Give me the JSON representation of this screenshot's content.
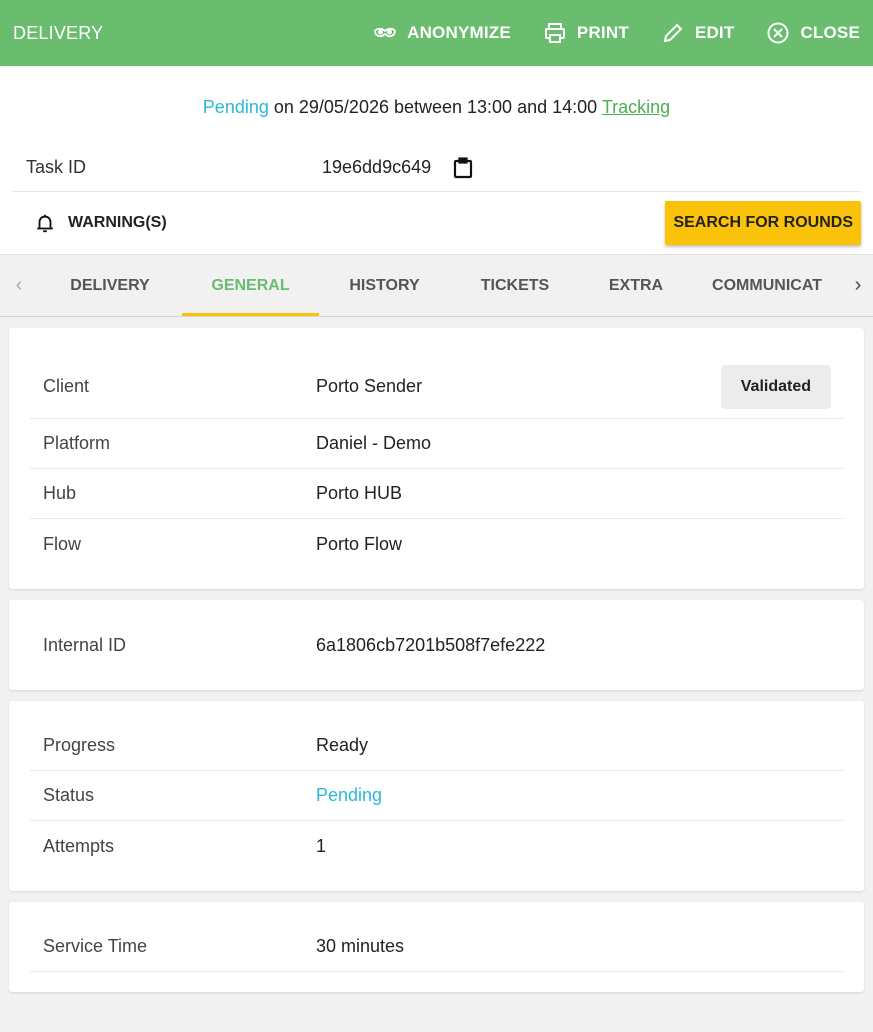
{
  "topbar": {
    "title": "DELIVERY",
    "actions": {
      "anonymize": "ANONYMIZE",
      "print": "PRINT",
      "edit": "EDIT",
      "close": "CLOSE"
    }
  },
  "status_line": {
    "status": "Pending",
    "text": " on 29/05/2026 between 13:00 and 14:00 ",
    "tracking": "Tracking"
  },
  "task": {
    "label": "Task ID",
    "value": "19e6dd9c649"
  },
  "warnings": {
    "label": "WARNING(S)",
    "search_button": "SEARCH FOR ROUNDS"
  },
  "tabs": [
    {
      "label": "DELIVERY"
    },
    {
      "label": "GENERAL"
    },
    {
      "label": "HISTORY"
    },
    {
      "label": "TICKETS"
    },
    {
      "label": "EXTRA"
    },
    {
      "label": "COMMUNICAT"
    }
  ],
  "card1": {
    "client": {
      "label": "Client",
      "value": "Porto Sender",
      "badge": "Validated"
    },
    "platform": {
      "label": "Platform",
      "value": "Daniel - Demo"
    },
    "hub": {
      "label": "Hub",
      "value": "Porto HUB"
    },
    "flow": {
      "label": "Flow",
      "value": "Porto Flow"
    }
  },
  "card2": {
    "internal_id": {
      "label": "Internal ID",
      "value": "6a1806cb7201b508f7efe222"
    }
  },
  "card3": {
    "progress": {
      "label": "Progress",
      "value": "Ready"
    },
    "status": {
      "label": "Status",
      "value": "Pending"
    },
    "attempts": {
      "label": "Attempts",
      "value": "1"
    }
  },
  "card4": {
    "service_time": {
      "label": "Service Time",
      "value": "30 minutes"
    }
  },
  "colors": {
    "topbar_green": "#6abd6e",
    "accent_yellow": "#fbc20a",
    "pending_blue": "#2bb8d8",
    "tracking_green": "#4caf50"
  }
}
